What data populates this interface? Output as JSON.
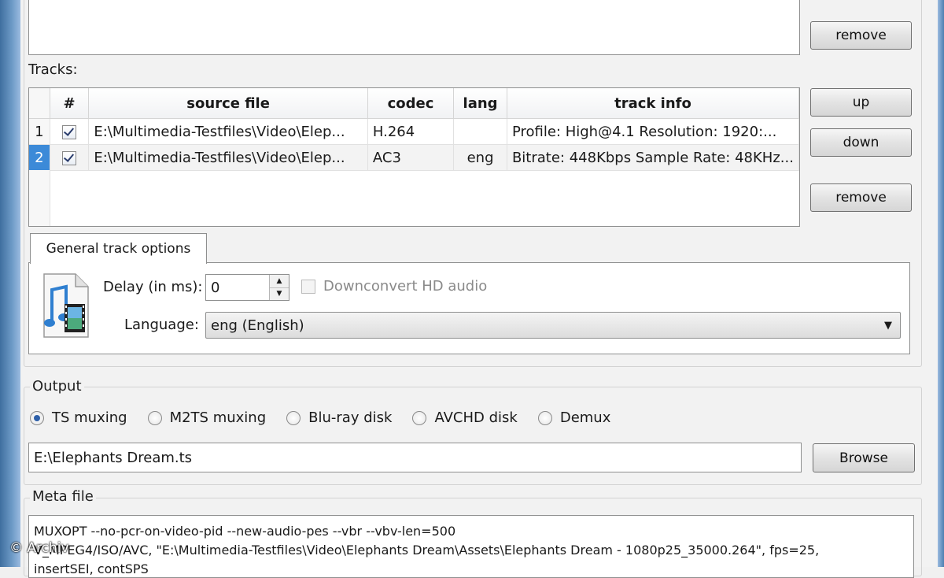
{
  "sources": {
    "remove_label": "remove"
  },
  "tracks": {
    "label": "Tracks:",
    "columns": [
      "#",
      "source file",
      "codec",
      "lang",
      "track info"
    ],
    "rows": [
      {
        "num": "1",
        "checked": true,
        "source": "E:\\Multimedia-Testfiles\\Video\\Elep...",
        "codec": "H.264",
        "lang": "",
        "info": "Profile: High@4.1  Resolution: 1920:..."
      },
      {
        "num": "2",
        "checked": true,
        "source": "E:\\Multimedia-Testfiles\\Video\\Elep...",
        "codec": "AC3",
        "lang": "eng",
        "info": "Bitrate: 448Kbps Sample Rate: 48KHz..."
      }
    ],
    "up_label": "up",
    "down_label": "down",
    "remove_label": "remove"
  },
  "general": {
    "tab_label": "General track options",
    "delay_label": "Delay (in ms):",
    "delay_value": "0",
    "downconvert_label": "Downconvert HD audio",
    "language_label": "Language:",
    "language_value": "eng (English)"
  },
  "output": {
    "title": "Output",
    "options": [
      "TS muxing",
      "M2TS muxing",
      "Blu-ray disk",
      "AVCHD disk",
      "Demux"
    ],
    "selected": "TS muxing",
    "path": "E:\\Elephants Dream.ts",
    "browse_label": "Browse"
  },
  "meta": {
    "title": "Meta file",
    "line1": "MUXOPT --no-pcr-on-video-pid --new-audio-pes --vbr  --vbv-len=500",
    "line2": "V_MPEG4/ISO/AVC, \"E:\\Multimedia-Testfiles\\Video\\Elephants Dream\\Assets\\Elephants Dream - 1080p25_35000.264\", fps=25,",
    "line3": "insertSEI, contSPS"
  },
  "watermark": "© Archiv"
}
